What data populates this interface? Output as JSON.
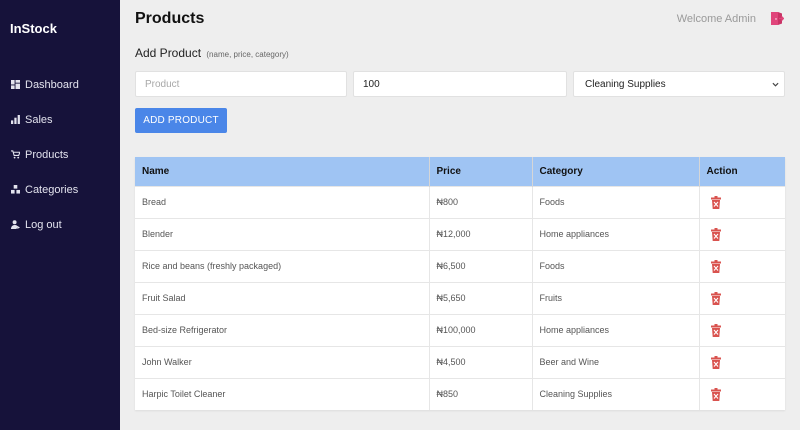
{
  "sidebar": {
    "brand": "InStock",
    "items": [
      {
        "label": "Dashboard",
        "icon": "dashboard-icon"
      },
      {
        "label": "Sales",
        "icon": "bar-chart-icon"
      },
      {
        "label": "Products",
        "icon": "cart-icon"
      },
      {
        "label": "Categories",
        "icon": "cubes-icon"
      },
      {
        "label": "Log out",
        "icon": "user-logout-icon"
      }
    ]
  },
  "header": {
    "title": "Products",
    "welcome": "Welcome Admin",
    "logout_icon": "door-exit-icon"
  },
  "form": {
    "title": "Add Product",
    "hint": "(name, price, category)",
    "product_placeholder": "Product",
    "price_value": "100",
    "category_selected": "Cleaning Supplies",
    "submit_label": "ADD PRODUCT"
  },
  "table": {
    "columns": [
      "Name",
      "Price",
      "Category",
      "Action"
    ],
    "rows": [
      {
        "name": "Bread",
        "price": "₦800",
        "category": "Foods"
      },
      {
        "name": "Blender",
        "price": "₦12,000",
        "category": "Home appliances"
      },
      {
        "name": "Rice and beans (freshly packaged)",
        "price": "₦6,500",
        "category": "Foods"
      },
      {
        "name": "Fruit Salad",
        "price": "₦5,650",
        "category": "Fruits"
      },
      {
        "name": "Bed-size Refrigerator",
        "price": "₦100,000",
        "category": "Home appliances"
      },
      {
        "name": "John Walker",
        "price": "₦4,500",
        "category": "Beer and Wine"
      },
      {
        "name": "Harpic Toilet Cleaner",
        "price": "₦850",
        "category": "Cleaning Supplies"
      }
    ],
    "delete_icon": "trash-icon"
  },
  "colors": {
    "sidebar_bg": "#16123a",
    "accent": "#4a86e8",
    "table_header_bg": "#9fc4f3",
    "delete_red": "#d9534f",
    "logout_pink": "#e0457b"
  }
}
